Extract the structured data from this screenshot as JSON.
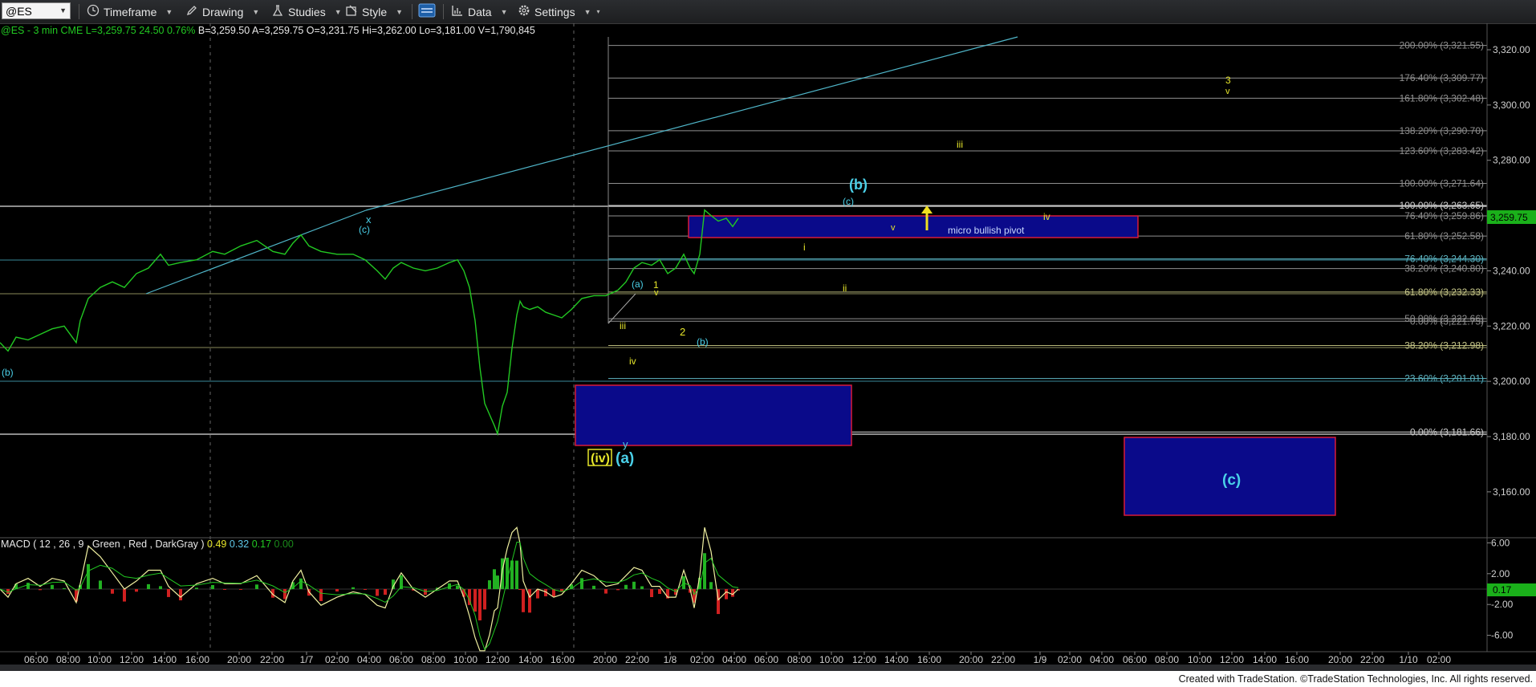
{
  "toolbar": {
    "symbol": "@ES",
    "timeframe": "Timeframe",
    "drawing": "Drawing",
    "studies": "Studies",
    "style": "Style",
    "data": "Data",
    "settings": "Settings"
  },
  "header": {
    "title": "@ES - 3 min",
    "exchange": "CME",
    "last": "L=3,259.75",
    "change": "24.50",
    "change_pct": "0.76%",
    "bid": "B=3,259.50",
    "ask": "A=3,259.75",
    "open": "O=3,231.75",
    "high": "Hi=3,262.00",
    "low": "Lo=3,181.00",
    "volume": "V=1,790,845"
  },
  "colors": {
    "price": "#22c822",
    "fib_gray": "#9a9a9a",
    "fib_olive": "#c8c88a",
    "fib_teal": "#5fb7c4",
    "box_fill": "#0a0a8a",
    "box_border": "#d81a3a",
    "wave_yellow": "#e6e62a",
    "wave_cyan": "#4ad0e8"
  },
  "chart_data": {
    "type": "line",
    "price_axis": {
      "ticks": [
        "3,320.00",
        "3,300.00",
        "3,280.00",
        "3,260.00",
        "3,240.00",
        "3,220.00",
        "3,200.00",
        "3,180.00",
        "3,160.00"
      ],
      "tick_values": [
        3320,
        3300,
        3280,
        3260,
        3240,
        3220,
        3200,
        3180,
        3160
      ],
      "last_price_label": "3,259.75",
      "ylim": [
        3148,
        3327
      ]
    },
    "time_axis": {
      "ticks": [
        "06:00",
        "08:00",
        "10:00",
        "12:00",
        "14:00",
        "16:00",
        "20:00",
        "22:00",
        "1/7",
        "02:00",
        "04:00",
        "06:00",
        "08:00",
        "10:00",
        "12:00",
        "14:00",
        "16:00",
        "20:00",
        "22:00",
        "1/8",
        "02:00",
        "04:00",
        "06:00",
        "08:00",
        "10:00",
        "12:00",
        "14:00",
        "16:00",
        "20:00",
        "22:00",
        "1/9",
        "02:00",
        "04:00",
        "06:00",
        "08:00",
        "10:00",
        "12:00",
        "14:00",
        "16:00",
        "20:00",
        "22:00",
        "1/10",
        "02:00"
      ]
    },
    "series": [
      {
        "name": "@ES - 3 min",
        "points": [
          [
            0,
            3214
          ],
          [
            10,
            3211
          ],
          [
            20,
            3216
          ],
          [
            35,
            3215
          ],
          [
            50,
            3217
          ],
          [
            65,
            3219
          ],
          [
            80,
            3220
          ],
          [
            95,
            3214
          ],
          [
            100,
            3222
          ],
          [
            110,
            3230
          ],
          [
            125,
            3234
          ],
          [
            140,
            3236
          ],
          [
            155,
            3234
          ],
          [
            170,
            3239
          ],
          [
            185,
            3241
          ],
          [
            200,
            3246
          ],
          [
            210,
            3242
          ],
          [
            225,
            3243
          ],
          [
            245,
            3244
          ],
          [
            265,
            3247
          ],
          [
            280,
            3246
          ],
          [
            300,
            3249
          ],
          [
            320,
            3251
          ],
          [
            340,
            3247
          ],
          [
            355,
            3246
          ],
          [
            365,
            3250
          ],
          [
            375,
            3253
          ],
          [
            385,
            3249
          ],
          [
            400,
            3247
          ],
          [
            420,
            3246
          ],
          [
            440,
            3246
          ],
          [
            455,
            3244
          ],
          [
            470,
            3240
          ],
          [
            480,
            3237
          ],
          [
            490,
            3241
          ],
          [
            500,
            3243
          ],
          [
            515,
            3241
          ],
          [
            530,
            3240
          ],
          [
            545,
            3241
          ],
          [
            560,
            3243
          ],
          [
            570,
            3244
          ],
          [
            578,
            3240
          ],
          [
            585,
            3234
          ],
          [
            592,
            3222
          ],
          [
            598,
            3205
          ],
          [
            604,
            3192
          ],
          [
            610,
            3188
          ],
          [
            616,
            3184
          ],
          [
            620,
            3181
          ],
          [
            626,
            3191
          ],
          [
            632,
            3196
          ],
          [
            638,
            3212
          ],
          [
            644,
            3224
          ],
          [
            648,
            3229
          ],
          [
            652,
            3227
          ],
          [
            660,
            3226
          ],
          [
            670,
            3227
          ],
          [
            680,
            3225
          ],
          [
            690,
            3224
          ],
          [
            700,
            3223
          ],
          [
            712,
            3226
          ],
          [
            725,
            3230
          ],
          [
            740,
            3231
          ],
          [
            755,
            3231
          ],
          [
            770,
            3233
          ],
          [
            780,
            3236
          ],
          [
            790,
            3241
          ],
          [
            800,
            3243
          ],
          [
            812,
            3242
          ],
          [
            822,
            3244
          ],
          [
            832,
            3239
          ],
          [
            842,
            3241
          ],
          [
            852,
            3246
          ],
          [
            860,
            3241
          ],
          [
            865,
            3239
          ],
          [
            872,
            3246
          ],
          [
            878,
            3262
          ],
          [
            886,
            3260
          ],
          [
            895,
            3258
          ],
          [
            905,
            3259
          ],
          [
            913,
            3256
          ],
          [
            920,
            3259
          ]
        ]
      },
      {
        "name": "MACD ( 12 , 26 , 9 , Green , Red , DarkGray )",
        "values_readout": [
          "0.49",
          "0.32",
          "0.17",
          "0.00"
        ],
        "axis_ticks": [
          "6.00",
          "2.00",
          "-2.00",
          "-6.00"
        ],
        "axis_values": [
          6,
          2,
          -2,
          -6
        ],
        "last_label": "0.17"
      }
    ],
    "fib_levels": [
      {
        "label": "200.00% (3,321.55)",
        "value": 3321.55,
        "tone": "gray"
      },
      {
        "label": "176.40% (3,309.77)",
        "value": 3309.77,
        "tone": "gray"
      },
      {
        "label": "161.80% (3,302.48)",
        "value": 3302.48,
        "tone": "gray"
      },
      {
        "label": "138.20% (3,290.70)",
        "value": 3290.7,
        "tone": "gray"
      },
      {
        "label": "123.60% (3,283.42)",
        "value": 3283.42,
        "tone": "gray"
      },
      {
        "label": "100.00% (3,271.64)",
        "value": 3271.64,
        "tone": "gray"
      },
      {
        "label": "100.00% (3,263.65)",
        "value": 3263.65,
        "tone": "white"
      },
      {
        "label": "76.40% (3,259.86)",
        "value": 3259.86,
        "tone": "gray"
      },
      {
        "label": "61.80% (3,252.58)",
        "value": 3252.58,
        "tone": "gray"
      },
      {
        "label": "76.40% (3,244.30)",
        "value": 3244.3,
        "tone": "teal"
      },
      {
        "label": "38.20% (3,240.80)",
        "value": 3240.8,
        "tone": "gray"
      },
      {
        "label": "61.80% (3,232.33)",
        "value": 3232.33,
        "tone": "olive"
      },
      {
        "label": "50.00% (3,222.66)",
        "value": 3222.66,
        "tone": "gray"
      },
      {
        "label": "0.00% (3,221.75)",
        "value": 3221.75,
        "tone": "gray"
      },
      {
        "label": "38.20% (3,212.98)",
        "value": 3212.98,
        "tone": "olive"
      },
      {
        "label": "23.60% (3,201.01)",
        "value": 3201.01,
        "tone": "teal"
      },
      {
        "label": "0.00% (3,181.66)",
        "value": 3181.66,
        "tone": "white"
      }
    ],
    "annotations": {
      "pivot_label": "micro bullish pivot",
      "waves": [
        {
          "text": "(b)",
          "color": "wave_cyan"
        },
        {
          "text": "x",
          "color": "wave_cyan"
        },
        {
          "text": "(c)",
          "color": "wave_cyan"
        },
        {
          "text": "(a)",
          "color": "wave_cyan"
        },
        {
          "text": "(iv)",
          "color": "wave_yellow"
        },
        {
          "text": "y",
          "color": "wave_cyan"
        },
        {
          "text": "1",
          "color": "wave_yellow"
        },
        {
          "text": "v",
          "color": "wave_yellow"
        },
        {
          "text": "iii",
          "color": "wave_yellow"
        },
        {
          "text": "iv",
          "color": "wave_yellow"
        },
        {
          "text": "2",
          "color": "wave_yellow"
        },
        {
          "text": "i",
          "color": "wave_yellow"
        },
        {
          "text": "ii",
          "color": "wave_yellow"
        },
        {
          "text": "3",
          "color": "wave_yellow"
        }
      ]
    }
  },
  "footer": {
    "credit": "Created with TradeStation. ©TradeStation Technologies, Inc. All rights reserved."
  }
}
